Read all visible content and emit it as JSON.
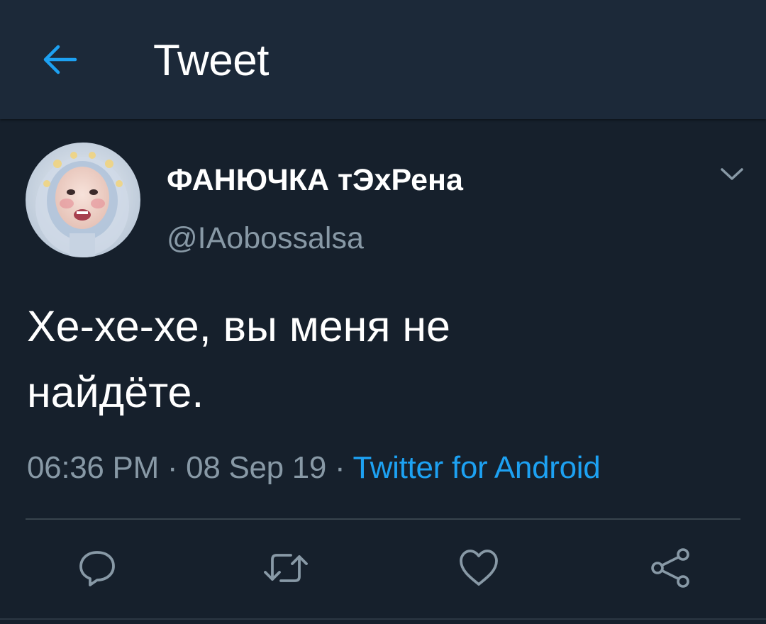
{
  "header": {
    "back_icon": "arrow-left-icon",
    "title": "Tweet"
  },
  "tweet": {
    "author": {
      "display_name": "ФАНЮЧКА тЭхРена",
      "handle": "@IAobossalsa",
      "avatar": "avatar-photo"
    },
    "menu_icon": "chevron-down-icon",
    "text": "Хе-хе-хе, вы меня не\nнайдёте.",
    "time": "06:36 PM",
    "separator": "·",
    "date": "08 Sep 19",
    "source": "Twitter for Android"
  },
  "actions": [
    {
      "name": "reply",
      "icon": "comment-icon"
    },
    {
      "name": "retweet",
      "icon": "retweet-icon"
    },
    {
      "name": "like",
      "icon": "heart-icon"
    },
    {
      "name": "share",
      "icon": "share-icon"
    }
  ],
  "colors": {
    "background": "#16202c",
    "header_background": "#1c2939",
    "accent": "#1da1f2",
    "secondary_text": "#8899a6",
    "divider": "#38444d"
  }
}
